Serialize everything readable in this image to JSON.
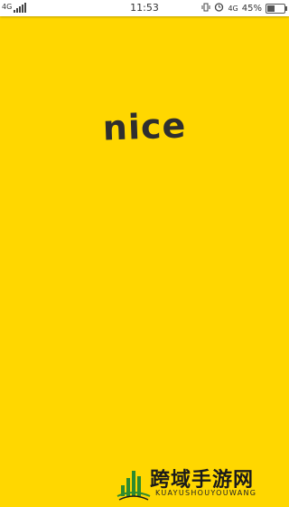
{
  "status_bar": {
    "network": "4G",
    "time": "11:53",
    "right_network": "4G",
    "battery_text": "45%",
    "battery_level": 0.45,
    "icons": [
      "signal-icon",
      "vibrate-icon",
      "alarm-icon",
      "battery-icon"
    ]
  },
  "splash": {
    "logo_text": "nice",
    "background_color": "#ffd700",
    "logo_color": "#2f2f2f"
  },
  "watermark": {
    "chinese": "跨域手游网",
    "english": "KUAYUSHOUYOUWANG",
    "accent_color": "#2e8b2e"
  }
}
